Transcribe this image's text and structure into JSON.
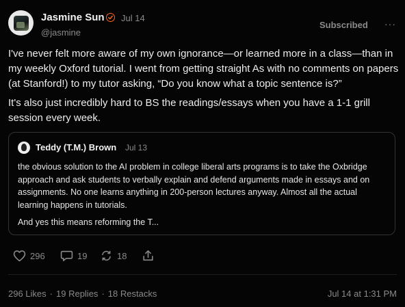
{
  "post": {
    "author_name": "Jasmine Sun",
    "date": "Jul 14",
    "handle": "@jasmine",
    "subscribe_label": "Subscribed",
    "more_label": "···",
    "paragraphs": [
      "I've never felt more aware of my own ignorance—or learned more in a class—than in my weekly Oxford tutorial. I went from getting straight As with no comments on papers (at Stanford!) to my tutor asking, “Do you know what a topic sentence is?”",
      "It's also just incredibly hard to BS the readings/essays when you have a 1-1 grill session every week."
    ]
  },
  "quote": {
    "author_name": "Teddy (T.M.) Brown",
    "date": "Jul 13",
    "paragraphs": [
      "the obvious solution to the AI problem in college liberal arts programs is to take the Oxbridge approach and ask students to verbally explain and defend arguments made in essays and on assignments. No one learns anything in 200-person lectures anyway. Almost all the actual learning happens in tutorials.",
      "And yes this means reforming the T..."
    ]
  },
  "actions": {
    "likes": "296",
    "replies": "19",
    "restacks": "18"
  },
  "footer": {
    "likes_text": "296 Likes",
    "replies_text": "19 Replies",
    "restacks_text": "18 Restacks",
    "separator": "·",
    "timestamp": "Jul 14 at 1:31 PM"
  },
  "colors": {
    "background": "#050505",
    "accent": "#ff6719",
    "muted": "#8a8a8a"
  },
  "icons": [
    "verified-check-icon",
    "heart-icon",
    "comment-icon",
    "restack-icon",
    "share-icon",
    "more-icon"
  ]
}
